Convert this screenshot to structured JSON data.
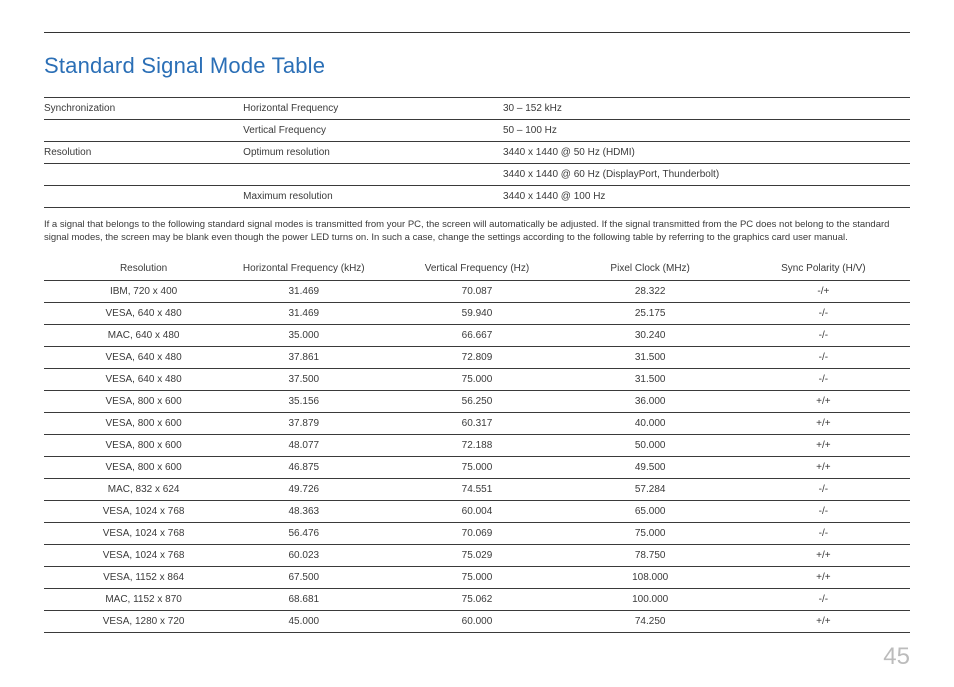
{
  "title": "Standard Signal Mode Table",
  "spec_rows": [
    {
      "c0": "Synchronization",
      "c1": "Horizontal Frequency",
      "c2": "30 – 152 kHz"
    },
    {
      "c0": "",
      "c1": "Vertical Frequency",
      "c2": "50 – 100 Hz"
    },
    {
      "c0": "Resolution",
      "c1": "Optimum resolution",
      "c2": "3440 x 1440 @ 50 Hz (HDMI)"
    },
    {
      "c0": "",
      "c1": "",
      "c2": "3440 x 1440 @ 60 Hz (DisplayPort, Thunderbolt)"
    },
    {
      "c0": "",
      "c1": "Maximum resolution",
      "c2": "3440 x 1440 @ 100 Hz"
    }
  ],
  "note": "If a signal that belongs to the following standard signal modes is transmitted from your PC, the screen will automatically be adjusted. If the signal transmitted from the PC does not belong to the standard signal modes, the screen may be blank even though the power LED turns on. In such a case, change the settings according to the following table by referring to the graphics card user manual.",
  "modes_headers": [
    "Resolution",
    "Horizontal Frequency (kHz)",
    "Vertical Frequency (Hz)",
    "Pixel Clock (MHz)",
    "Sync Polarity (H/V)"
  ],
  "modes_rows": [
    [
      "IBM, 720 x 400",
      "31.469",
      "70.087",
      "28.322",
      "-/+"
    ],
    [
      "VESA, 640 x 480",
      "31.469",
      "59.940",
      "25.175",
      "-/-"
    ],
    [
      "MAC, 640 x 480",
      "35.000",
      "66.667",
      "30.240",
      "-/-"
    ],
    [
      "VESA, 640 x 480",
      "37.861",
      "72.809",
      "31.500",
      "-/-"
    ],
    [
      "VESA, 640 x 480",
      "37.500",
      "75.000",
      "31.500",
      "-/-"
    ],
    [
      "VESA, 800 x 600",
      "35.156",
      "56.250",
      "36.000",
      "+/+"
    ],
    [
      "VESA, 800 x 600",
      "37.879",
      "60.317",
      "40.000",
      "+/+"
    ],
    [
      "VESA, 800 x 600",
      "48.077",
      "72.188",
      "50.000",
      "+/+"
    ],
    [
      "VESA, 800 x 600",
      "46.875",
      "75.000",
      "49.500",
      "+/+"
    ],
    [
      "MAC, 832 x 624",
      "49.726",
      "74.551",
      "57.284",
      "-/-"
    ],
    [
      "VESA, 1024 x 768",
      "48.363",
      "60.004",
      "65.000",
      "-/-"
    ],
    [
      "VESA, 1024 x 768",
      "56.476",
      "70.069",
      "75.000",
      "-/-"
    ],
    [
      "VESA, 1024 x 768",
      "60.023",
      "75.029",
      "78.750",
      "+/+"
    ],
    [
      "VESA, 1152 x 864",
      "67.500",
      "75.000",
      "108.000",
      "+/+"
    ],
    [
      "MAC, 1152 x 870",
      "68.681",
      "75.062",
      "100.000",
      "-/-"
    ],
    [
      "VESA, 1280 x 720",
      "45.000",
      "60.000",
      "74.250",
      "+/+"
    ]
  ],
  "page_number": "45",
  "chart_data": {
    "type": "table",
    "title": "Standard Signal Mode Table",
    "columns": [
      "Resolution",
      "Horizontal Frequency (kHz)",
      "Vertical Frequency (Hz)",
      "Pixel Clock (MHz)",
      "Sync Polarity (H/V)"
    ],
    "rows": [
      [
        "IBM, 720 x 400",
        31.469,
        70.087,
        28.322,
        "-/+"
      ],
      [
        "VESA, 640 x 480",
        31.469,
        59.94,
        25.175,
        "-/-"
      ],
      [
        "MAC, 640 x 480",
        35.0,
        66.667,
        30.24,
        "-/-"
      ],
      [
        "VESA, 640 x 480",
        37.861,
        72.809,
        31.5,
        "-/-"
      ],
      [
        "VESA, 640 x 480",
        37.5,
        75.0,
        31.5,
        "-/-"
      ],
      [
        "VESA, 800 x 600",
        35.156,
        56.25,
        36.0,
        "+/+"
      ],
      [
        "VESA, 800 x 600",
        37.879,
        60.317,
        40.0,
        "+/+"
      ],
      [
        "VESA, 800 x 600",
        48.077,
        72.188,
        50.0,
        "+/+"
      ],
      [
        "VESA, 800 x 600",
        46.875,
        75.0,
        49.5,
        "+/+"
      ],
      [
        "MAC, 832 x 624",
        49.726,
        74.551,
        57.284,
        "-/-"
      ],
      [
        "VESA, 1024 x 768",
        48.363,
        60.004,
        65.0,
        "-/-"
      ],
      [
        "VESA, 1024 x 768",
        56.476,
        70.069,
        75.0,
        "-/-"
      ],
      [
        "VESA, 1024 x 768",
        60.023,
        75.029,
        78.75,
        "+/+"
      ],
      [
        "VESA, 1152 x 864",
        67.5,
        75.0,
        108.0,
        "+/+"
      ],
      [
        "MAC, 1152 x 870",
        68.681,
        75.062,
        100.0,
        "-/-"
      ],
      [
        "VESA, 1280 x 720",
        45.0,
        60.0,
        74.25,
        "+/+"
      ]
    ]
  }
}
